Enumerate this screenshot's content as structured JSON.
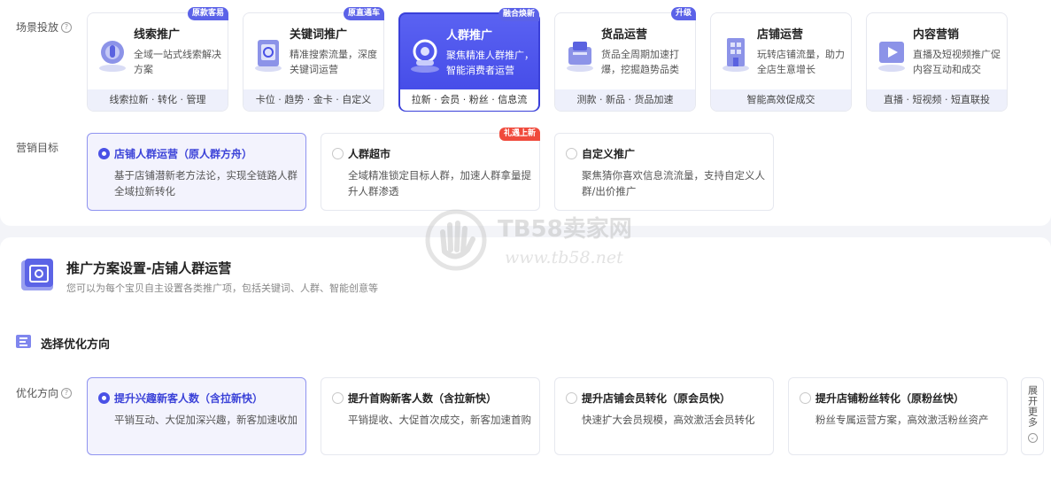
{
  "scene": {
    "label": "场景投放",
    "cards": [
      {
        "title": "线索推广",
        "desc": "全域一站式线索解决方案",
        "foot": "线索拉新 · 转化 · 管理",
        "badge": "原款客易",
        "active": false
      },
      {
        "title": "关键词推广",
        "desc": "精准搜索流量，深度关键词运营",
        "foot": "卡位 · 趋势 · 金卡 · 自定义",
        "badge": "原直通车",
        "active": false
      },
      {
        "title": "人群推广",
        "desc": "聚焦精准人群推广，智能消费者运营",
        "foot": "拉新 · 会员 · 粉丝 · 信息流",
        "badge": "融合焕新",
        "active": true
      },
      {
        "title": "货品运营",
        "desc": "货品全周期加速打爆，挖掘趋势品类",
        "foot": "测款 · 新品 · 货品加速",
        "badge": "升级",
        "active": false
      },
      {
        "title": "店铺运营",
        "desc": "玩转店铺流量，助力全店生意增长",
        "foot": "智能高效促成交",
        "badge": "",
        "active": false
      },
      {
        "title": "内容营销",
        "desc": "直播及短视频推广促内容互动和成交",
        "foot": "直播 · 短视频 · 短直联投",
        "badge": "",
        "active": false
      }
    ]
  },
  "goal": {
    "label": "营销目标",
    "options": [
      {
        "title": "店铺人群运营（原人群方舟）",
        "desc": "基于店铺潜新老方法论，实现全链路人群全域拉新转化",
        "tag": "",
        "selected": true
      },
      {
        "title": "人群超市",
        "desc": "全域精准锁定目标人群，加速人群拿量提升人群渗透",
        "tag": "礼遇上新",
        "selected": false
      },
      {
        "title": "自定义推广",
        "desc": "聚焦猜你喜欢信息流流量，支持自定义人群/出价推广",
        "tag": "",
        "selected": false
      }
    ]
  },
  "plan": {
    "title": "推广方案设置-店铺人群运营",
    "subtitle": "您可以为每个宝贝自主设置各类推广项，包括关键词、人群、智能创意等"
  },
  "optimize": {
    "section_title": "选择优化方向",
    "label": "优化方向",
    "options": [
      {
        "title": "提升兴趣新客人数（含拉新快）",
        "desc": "平销互动、大促加深兴趣，新客加速收加",
        "selected": true
      },
      {
        "title": "提升首购新客人数（含拉新快）",
        "desc": "平销提收、大促首次成交，新客加速首购",
        "selected": false
      },
      {
        "title": "提升店铺会员转化（原会员快）",
        "desc": "快速扩大会员规模，高效激活会员转化",
        "selected": false
      },
      {
        "title": "提升店铺粉丝转化（原粉丝快）",
        "desc": "粉丝专属运营方案，高效激活粉丝资产",
        "selected": false
      }
    ],
    "expand_label": "展开更多"
  },
  "watermark": {
    "name": "TB58卖家网",
    "url": "www.tb58.net"
  },
  "colors": {
    "accent": "#4a51e6",
    "hot": "#f04a3c"
  }
}
